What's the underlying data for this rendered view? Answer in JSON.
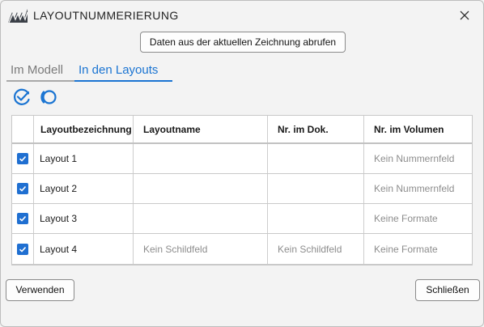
{
  "window": {
    "title": "LAYOUTNUMMERIERUNG",
    "icons": {
      "logo": "app-logo-icon",
      "close": "close-icon"
    }
  },
  "toolbar": {
    "fetch_label": "Daten aus der aktuellen Zeichnung abrufen",
    "check_all_icon": "check-all-icon",
    "uncheck_all_icon": "uncheck-all-icon"
  },
  "tabs": [
    {
      "label": "Im Modell",
      "active": false
    },
    {
      "label": "In den Layouts",
      "active": true
    }
  ],
  "table": {
    "columns": [
      "",
      "Layoutbezeichnung",
      "Layoutname",
      "Nr. im Dok.",
      "Nr. im Volumen"
    ],
    "rows": [
      {
        "checked": true,
        "layout": "Layout 1",
        "name": "",
        "doc_nr": "",
        "vol_nr": "Kein Nummernfeld"
      },
      {
        "checked": true,
        "layout": "Layout 2",
        "name": "",
        "doc_nr": "",
        "vol_nr": "Kein Nummernfeld"
      },
      {
        "checked": true,
        "layout": "Layout 3",
        "name": "",
        "doc_nr": "",
        "vol_nr": "Keine Formate"
      },
      {
        "checked": true,
        "layout": "Layout 4",
        "name": "Kein Schildfeld",
        "doc_nr": "Kein Schildfeld",
        "vol_nr": "Keine Formate"
      }
    ]
  },
  "footer": {
    "apply_label": "Verwenden",
    "close_label": "Schließen"
  },
  "colors": {
    "accent": "#1a74d2",
    "checkbox": "#1f6fd1",
    "muted_text": "#8d8d8d",
    "logo": "#3a3f47"
  }
}
